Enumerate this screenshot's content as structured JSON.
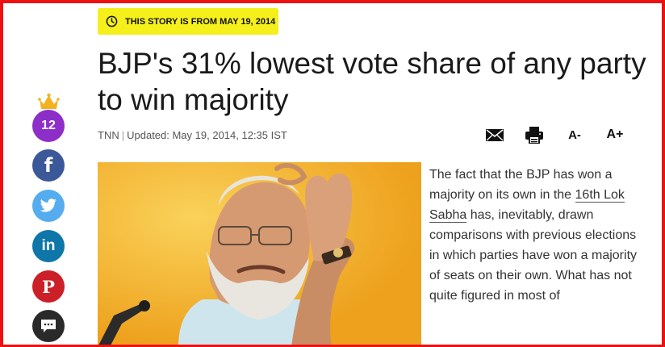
{
  "badge": {
    "text": "THIS STORY IS FROM MAY 19, 2014",
    "icon": "clock-icon"
  },
  "headline": "BJP's 31% lowest vote share of any party to win majority",
  "byline": {
    "source": "TNN",
    "separator": "|",
    "updated": "Updated: May 19, 2014, 12:35 IST"
  },
  "toolbar": {
    "mail_icon": "mail-icon",
    "print_icon": "print-icon",
    "font_decrease": "A-",
    "font_increase": "A+"
  },
  "social": {
    "share_count": "12",
    "crown_icon": "crown-icon",
    "facebook": "f",
    "linkedin": "in",
    "pinterest": "P",
    "twitter_icon": "twitter-icon",
    "comment_icon": "comment-icon",
    "colors": {
      "count": "#8d2ec9",
      "facebook": "#3b5998",
      "twitter": "#55acee",
      "linkedin": "#0e76a8",
      "pinterest": "#cb2027",
      "comment": "#2a2a2a"
    }
  },
  "article": {
    "text_before_link": "The fact that the BJP has won a majority on its own in the ",
    "link": "16th Lok Sabha",
    "text_after_link": " has, inevitably, drawn comparisons with previous elections in which parties have won a majority of seats on their own. What has not quite figured in most of"
  },
  "colors": {
    "frame": "#ee1111",
    "badge": "#f5ef1c"
  }
}
